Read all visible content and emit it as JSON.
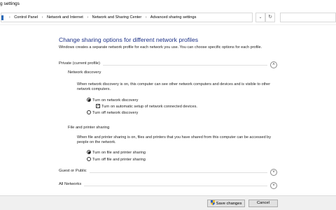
{
  "window": {
    "title": "g settings"
  },
  "address_bar": {
    "crumbs": [
      "Control Panel",
      "Network and Internet",
      "Network and Sharing Center",
      "Advanced sharing settings"
    ]
  },
  "page": {
    "heading": "Change sharing options for different network profiles",
    "intro": "Windows creates a separate network profile for each network you use. You can choose specific options for each profile."
  },
  "private_profile": {
    "label": "Private (current profile)",
    "network_discovery": {
      "title": "Network discovery",
      "description": "When network discovery is on, this computer can see other network computers and devices and is visible to other network computers.",
      "on_label": "Turn on network discovery",
      "auto_setup_label": "Turn on automatic setup of network connected devices.",
      "off_label": "Turn off network discovery",
      "selected": "on",
      "auto_setup_checked": true
    },
    "file_printer_sharing": {
      "title": "File and printer sharing",
      "description": "When file and printer sharing is on, files and printers that you have shared from this computer can be accessed by people on the network.",
      "on_label": "Turn on file and printer sharing",
      "off_label": "Turn off file and printer sharing",
      "selected": "on"
    }
  },
  "guest_profile": {
    "label": "Guest or Public"
  },
  "all_networks": {
    "label": "All Networks"
  },
  "footer": {
    "save_label": "Save changes",
    "cancel_label": "Cancel"
  },
  "icons": {
    "chevron_up": "chevron-up-icon",
    "chevron_down": "chevron-down-icon",
    "shield": "uac-shield-icon",
    "refresh": "refresh-icon"
  },
  "colors": {
    "heading": "#1e3287",
    "footer_bg": "#f0f0f0"
  }
}
